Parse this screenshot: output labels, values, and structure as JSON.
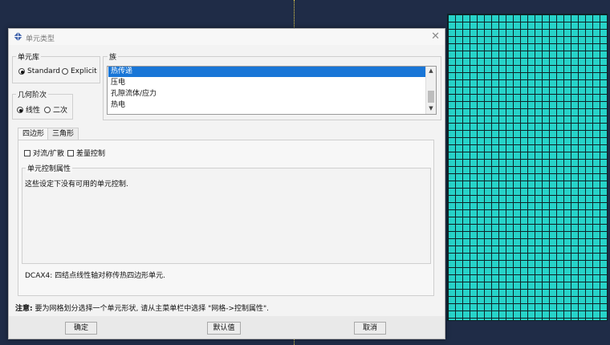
{
  "dialog": {
    "title": "单元类型",
    "close_symbol": "✕",
    "library": {
      "label": "单元库",
      "options": [
        "Standard",
        "Explicit"
      ],
      "selected": "Standard"
    },
    "order": {
      "label": "几何阶次",
      "options": [
        "线性",
        "二次"
      ],
      "selected": "线性"
    },
    "family": {
      "label": "族",
      "items": [
        "热传递",
        "压电",
        "孔隙流体/应力",
        "热电"
      ],
      "selected": "热传递"
    },
    "tabs": [
      "四边形",
      "三角形"
    ],
    "active_tab": "四边形",
    "checkboxes": [
      "对流/扩散",
      "差量控制"
    ],
    "element_controls_label": "单元控制属性",
    "element_controls_message": "这些设定下没有可用的单元控制.",
    "element_description": "DCAX4:  四结点线性轴对称传热四边形单元.",
    "note_label": "注意:",
    "note_text": "要为网格划分选择一个单元形状, 请从主菜单栏中选择 \"网格->控制属性\".",
    "buttons": {
      "ok": "确定",
      "defaults": "默认值",
      "cancel": "取消"
    }
  },
  "icons": {
    "title": "abaqus-logo-icon",
    "scroll_up": "▲",
    "scroll_down": "▼"
  },
  "colors": {
    "mesh": "#27d3c9",
    "selection": "#1976d7",
    "background": "#1f2c47"
  }
}
